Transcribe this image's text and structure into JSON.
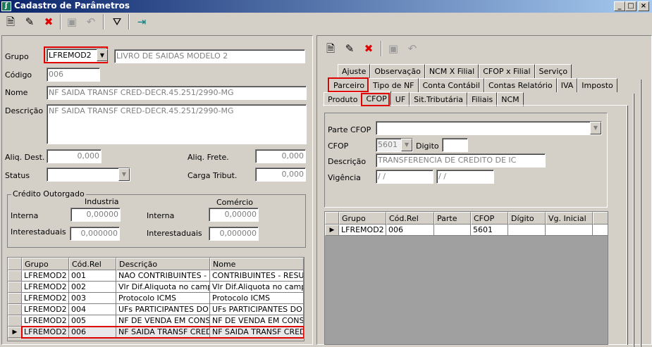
{
  "window": {
    "title": "Cadastro de Parâmetros",
    "minimize": "_",
    "maximize": "□",
    "close": "×"
  },
  "toolbar": {
    "new": "new-icon",
    "edit": "edit-icon",
    "delete": "delete-icon",
    "save": "save-icon",
    "undo": "undo-icon",
    "filter": "filter-icon",
    "exit": "exit-icon"
  },
  "form": {
    "grupo_label": "Grupo",
    "grupo_value": "LFREMOD2",
    "grupo_desc": "LIVRO DE SAIDAS MODELO 2",
    "codigo_label": "Código",
    "codigo_value": "006",
    "nome_label": "Nome",
    "nome_value": "NF SAIDA TRANSF CRED-DECR.45.251/2990-MG",
    "descricao_label": "Descrição",
    "descricao_value": "NF SAIDA TRANSF CRED-DECR.45.251/2990-MG",
    "aliq_dest_label": "Aliq. Dest.",
    "aliq_dest_value": "0,000",
    "aliq_frete_label": "Aliq. Frete.",
    "aliq_frete_value": "0,000",
    "status_label": "Status",
    "status_value": "",
    "carga_label": "Carga Tribut.",
    "carga_value": "0,000"
  },
  "credito": {
    "title": "Crédito Outorgado",
    "industria": "Industria",
    "comercio": "Comércio",
    "interna": "Interna",
    "interestaduais": "Interestaduais",
    "ind_interna": "0,00000",
    "ind_inter": "0,000000",
    "com_interna": "0,00000",
    "com_inter": "0,000000"
  },
  "left_grid": {
    "headers": [
      "Grupo",
      "Cód.Rel",
      "Descrição",
      "Nome"
    ],
    "rows": [
      [
        "LFREMOD2",
        "001",
        "NAO CONTRIBUINTES - RE",
        "CONTRIBUINTES - RESUM"
      ],
      [
        "LFREMOD2",
        "002",
        " Vlr Dif.Aliquota no campo",
        " Vlr Dif.Aliquota no campo"
      ],
      [
        "LFREMOD2",
        "003",
        "Protocolo ICMS",
        "Protocolo ICMS"
      ],
      [
        "LFREMOD2",
        "004",
        "UFs PARTICIPANTES DO P",
        "UFs PARTICIPANTES DO P"
      ],
      [
        "LFREMOD2",
        "005",
        "NF DE VENDA EM CONSIGI",
        "NF DE VENDA EM CONSIGI"
      ],
      [
        "LFREMOD2",
        "006",
        "NF SAIDA TRANSF CRED-I",
        "NF SAIDA TRANSF CRED-I"
      ]
    ]
  },
  "tabs": {
    "row1": [
      "Ajuste",
      "Observação",
      "NCM X Filial",
      "CFOP x Filial",
      "Serviço"
    ],
    "row2": [
      "Parceiro",
      "Tipo de NF",
      "Conta Contábil",
      "Contas Relatório",
      "IVA",
      "Imposto"
    ],
    "row3": [
      "Produto",
      "CFOP",
      "UF",
      "Sit.Tributária",
      "Filiais",
      "NCM"
    ]
  },
  "cfop": {
    "parte_label": "Parte  CFOP",
    "parte_value": "",
    "cfop_label": "CFOP",
    "cfop_value": "5601",
    "digito_label": "Digito",
    "digito_value": "",
    "descricao_label": "Descrição",
    "descricao_value": "TRANSFERENCIA DE CREDITO DE IC",
    "vigencia_label": "Vigência",
    "vig_ini": " / /",
    "vig_fim": " / /"
  },
  "right_grid": {
    "headers": [
      "Grupo",
      "Cód.Rel",
      "Parte",
      "CFOP",
      "Dígito",
      "Vg. Inicial",
      ""
    ],
    "rows": [
      [
        "LFREMOD2",
        "006",
        "",
        "5601",
        "",
        "",
        ""
      ]
    ]
  }
}
